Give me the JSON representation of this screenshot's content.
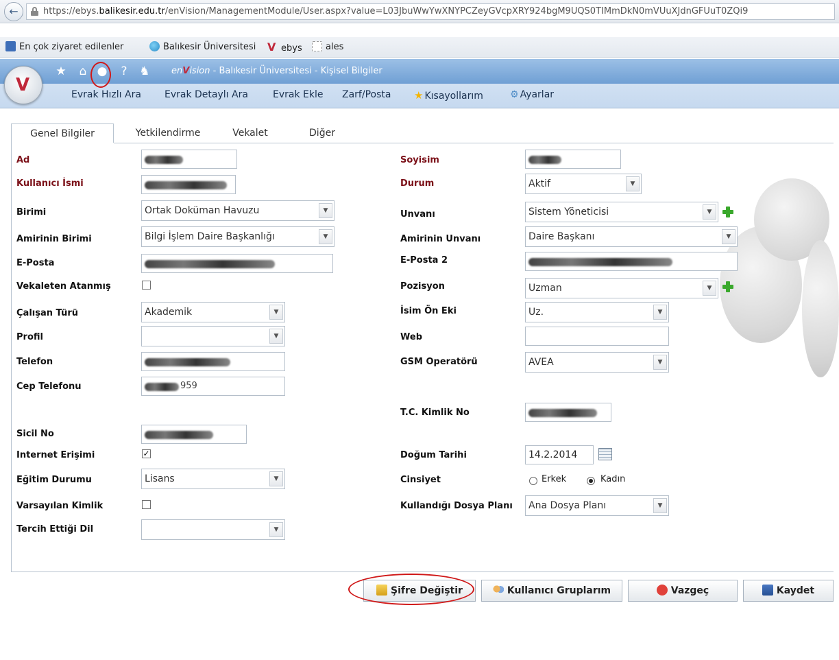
{
  "browser": {
    "url_prefix": "https://ebys.",
    "url_host": "balikesir.edu.tr",
    "url_rest": "/enVision/ManagementModule/User.aspx?value=L03JbuWwYwXNYPCZeyGVcpXRY924bgM9UQS0TIMmDkN0mVUuXJdnGFUuT0ZQi9",
    "bookmarks": [
      "En çok ziyaret edilenler",
      "Balıkesir Üniversitesi",
      "ebys",
      "ales"
    ]
  },
  "app": {
    "brand_prefix": "en",
    "brand_mark": "V",
    "brand_suffix": "ision",
    "title": " - Balıkesir Üniversitesi - Kişisel Bilgiler",
    "nav": [
      "Evrak Hızlı Ara",
      "Evrak Detaylı Ara",
      "Evrak Ekle",
      "Zarf/Posta",
      "Kısayollarım",
      "Ayarlar"
    ]
  },
  "tabs": [
    "Genel Bilgiler",
    "Yetkilendirme",
    "Vekalet",
    "Diğer"
  ],
  "form": {
    "ad": "Ad",
    "soyisim": "Soyisim",
    "kullanici_ismi": "Kullanıcı İsmi",
    "durum": "Durum",
    "durum_value": "Aktif",
    "birimi": "Birimi",
    "birimi_value": "Ortak Doküman Havuzu",
    "unvani": "Unvanı",
    "unvani_value": "Sistem Yöneticisi",
    "amirin_birimi": "Amirinin Birimi",
    "amirin_birimi_value": "Bilgi İşlem Daire Başkanlığı",
    "amirin_unvani": "Amirinin Unvanı",
    "amirin_unvani_value": "Daire Başkanı",
    "eposta": "E-Posta",
    "eposta2": "E-Posta 2",
    "vekaleten": "Vekaleten Atanmış",
    "pozisyon": "Pozisyon",
    "pozisyon_value": "Uzman",
    "calisan_turu": "Çalışan Türü",
    "calisan_turu_value": "Akademik",
    "isim_on_eki": "İsim Ön Eki",
    "isim_on_eki_value": "Uz.",
    "profil": "Profil",
    "web": "Web",
    "telefon": "Telefon",
    "gsm": "GSM Operatörü",
    "gsm_value": "AVEA",
    "cep": "Cep Telefonu",
    "tc": "T.C. Kimlik No",
    "sicil": "Sicil No",
    "internet": "Internet Erişimi",
    "dogum": "Doğum Tarihi",
    "dogum_value": "14.2.2014",
    "egitim": "Eğitim Durumu",
    "egitim_value": "Lisans",
    "cinsiyet": "Cinsiyet",
    "erkek": "Erkek",
    "kadin": "Kadın",
    "varsayilan": "Varsayılan Kimlik",
    "dosya_plani": "Kullandığı Dosya Planı",
    "dosya_plani_value": "Ana Dosya Planı",
    "tercih_dil": "Tercih Ettiği Dil",
    "cep_partial": "959"
  },
  "buttons": {
    "sifre": "Şifre Değiştir",
    "gruplar": "Kullanıcı Gruplarım",
    "vazgec": "Vazgeç",
    "kaydet": "Kaydet"
  },
  "colors": {
    "required_label": "#7b1018",
    "annotation_circle": "#d01818",
    "add_icon": "#3aa82c"
  }
}
